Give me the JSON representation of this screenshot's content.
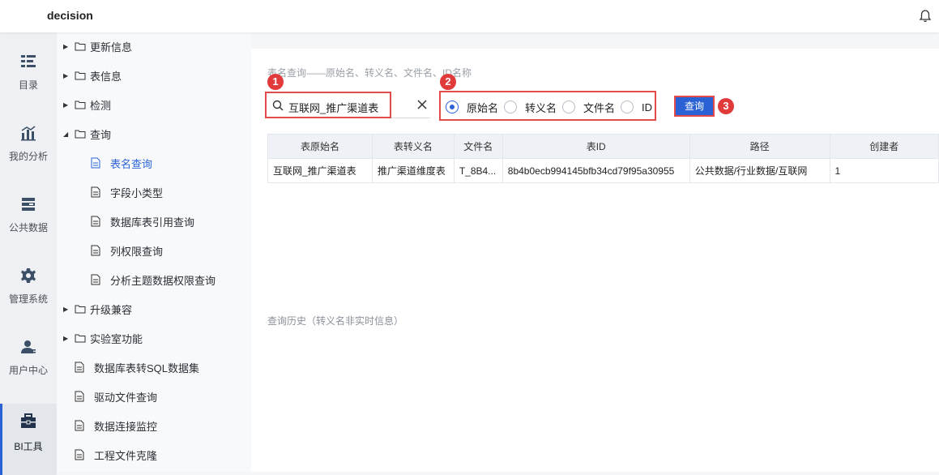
{
  "app": {
    "title": "decision"
  },
  "leftnav": [
    {
      "label": "目录",
      "icon": "catalog-icon"
    },
    {
      "label": "我的分析",
      "icon": "chart-icon"
    },
    {
      "label": "公共数据",
      "icon": "database-icon"
    },
    {
      "label": "管理系统",
      "icon": "gear-icon"
    },
    {
      "label": "用户中心",
      "icon": "user-icon"
    },
    {
      "label": "BI工具",
      "icon": "toolbox-icon",
      "active": true
    }
  ],
  "tree": [
    {
      "label": "更新信息",
      "type": "folder",
      "expanded": false
    },
    {
      "label": "表信息",
      "type": "folder",
      "expanded": false
    },
    {
      "label": "检测",
      "type": "folder",
      "expanded": false
    },
    {
      "label": "查询",
      "type": "folder",
      "expanded": true
    },
    {
      "label": "表名查询",
      "type": "doc",
      "child": true,
      "selected": true
    },
    {
      "label": "字段小类型",
      "type": "doc",
      "child": true
    },
    {
      "label": "数据库表引用查询",
      "type": "doc",
      "child": true
    },
    {
      "label": "列权限查询",
      "type": "doc",
      "child": true
    },
    {
      "label": "分析主题数据权限查询",
      "type": "doc",
      "child": true
    },
    {
      "label": "升级兼容",
      "type": "folder",
      "expanded": false
    },
    {
      "label": "实验室功能",
      "type": "folder",
      "expanded": false
    },
    {
      "label": "数据库表转SQL数据集",
      "type": "doc"
    },
    {
      "label": "驱动文件查询",
      "type": "doc"
    },
    {
      "label": "数据连接监控",
      "type": "doc"
    },
    {
      "label": "工程文件克隆",
      "type": "doc"
    }
  ],
  "main": {
    "hint": "表名查询——原始名、转义名、文件名、ID名称",
    "search_value": "互联网_推广渠道表",
    "radios": [
      {
        "label": "原始名",
        "checked": true
      },
      {
        "label": "转义名",
        "checked": false
      },
      {
        "label": "文件名",
        "checked": false
      },
      {
        "label": "ID",
        "checked": false
      }
    ],
    "query_label": "查询",
    "badges": [
      "1",
      "2",
      "3"
    ],
    "table": {
      "headers": [
        "表原始名",
        "表转义名",
        "文件名",
        "表ID",
        "路径",
        "创建者"
      ],
      "rows": [
        [
          "互联网_推广渠道表",
          "推广渠道维度表",
          "T_8B4...",
          "8b4b0ecb994145bfb34cd79f95a30955",
          "公共数据/行业数据/互联网",
          "1"
        ]
      ]
    },
    "history_label": "查询历史（转义名非实时信息）"
  },
  "colors": {
    "accent": "#2a62d6",
    "highlight": "#e34a4a"
  }
}
